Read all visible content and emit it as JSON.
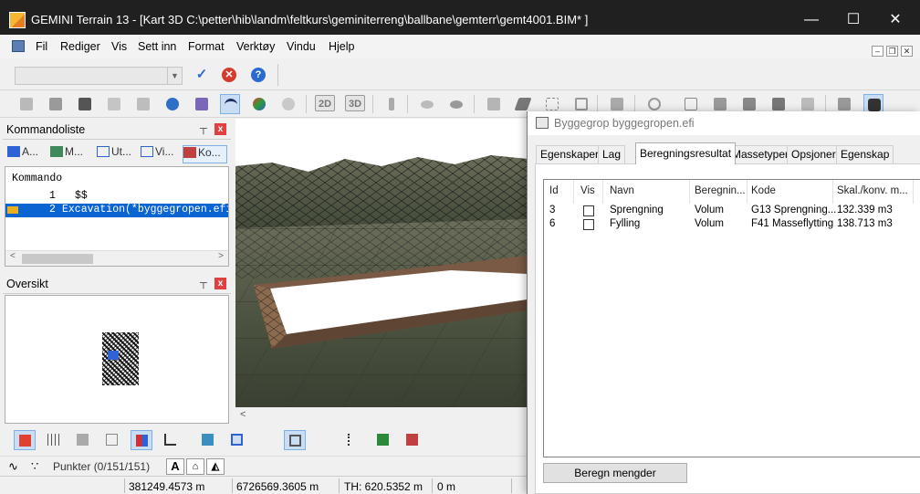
{
  "window": {
    "title": "GEMINI Terrain 13 - [Kart  3D  C:\\petter\\hib\\landm\\feltkurs\\geminiterreng\\ballbane\\gemterr\\gemt4001.BIM* ]",
    "minimize": "—",
    "maximize": "☐",
    "close": "✕"
  },
  "menu": {
    "items": [
      "Fil",
      "Rediger",
      "Vis",
      "Sett inn",
      "Format",
      "Verktøy",
      "Vindu",
      "Hjelp"
    ],
    "mdi_min": "–",
    "mdi_restore": "❐",
    "mdi_close": "✕"
  },
  "cmdbar": {
    "combo_value": "",
    "ok": "✓",
    "cancel": "✕",
    "help": "?"
  },
  "toolbar": {
    "btn_2d": "2D",
    "btn_3d": "3D"
  },
  "kommandoliste": {
    "title": "Kommandoliste",
    "pin": "📌",
    "close": "x",
    "tabs": [
      "A...",
      "M...",
      "Ut...",
      "Vi...",
      "Ko..."
    ],
    "header": "Kommando",
    "rows": [
      {
        "num": "1",
        "text": "$$"
      },
      {
        "num": "2",
        "text": "Excavation(*byggegropen.efi"
      }
    ],
    "scroll_left": "<",
    "scroll_right": ">"
  },
  "oversikt": {
    "title": "Oversikt",
    "pin": "📌",
    "close": "x"
  },
  "view": {
    "scroll_left": "<"
  },
  "pointsbar": {
    "label": "Punkter (0/151/151)",
    "text_btn": "A"
  },
  "status": {
    "x": "381249.4573 m",
    "y": "6726569.3605 m",
    "th": "TH: 620.5352 m",
    "z": "0 m"
  },
  "dialog": {
    "title": "Byggegrop byggegropen.efi",
    "tabs": [
      "Egenskaper",
      "Lag",
      "Beregningsresultat",
      "Massetyper",
      "Opsjoner",
      "Egenskap"
    ],
    "active_tab": "Beregningsresultat",
    "columns": [
      "Id",
      "Vis",
      "Navn",
      "Beregnin...",
      "Kode",
      "Skal./konv. m..."
    ],
    "rows": [
      {
        "id": "3",
        "vis": false,
        "navn": "Sprengning",
        "beregning": "Volum",
        "kode": "G13 Sprengning...",
        "verdi": "132.339 m3"
      },
      {
        "id": "6",
        "vis": false,
        "navn": "Fylling",
        "beregning": "Volum",
        "kode": "F41 Masseflytting",
        "verdi": "138.713 m3"
      }
    ],
    "calc_button": "Beregn mengder"
  },
  "colors": {
    "titlebar": "#202020",
    "selection": "#0a64d2",
    "accent": "#7fb0e4"
  }
}
